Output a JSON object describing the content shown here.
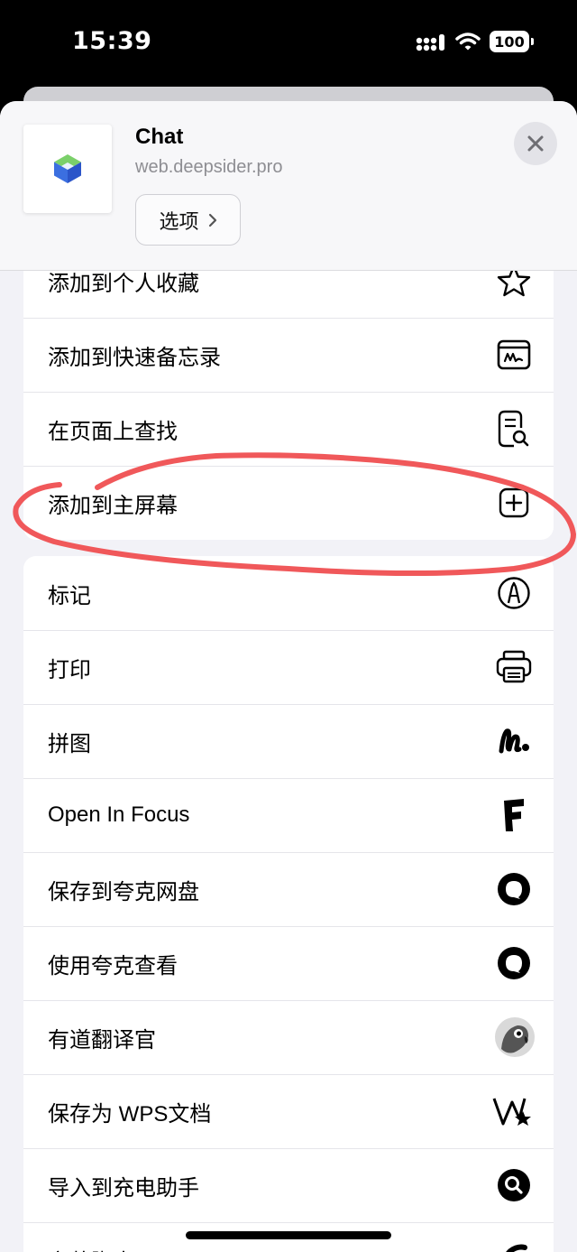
{
  "status_bar": {
    "time": "15:39",
    "battery": "100"
  },
  "header": {
    "title": "Chat",
    "url": "web.deepsider.pro",
    "options_label": "选项"
  },
  "group1": [
    {
      "label": "添加到个人收藏",
      "icon": "star-icon"
    },
    {
      "label": "添加到快速备忘录",
      "icon": "quick-note-icon"
    },
    {
      "label": "在页面上查找",
      "icon": "find-on-page-icon"
    },
    {
      "label": "添加到主屏幕",
      "icon": "add-square-icon"
    }
  ],
  "group2": [
    {
      "label": "标记",
      "icon": "markup-pen-icon"
    },
    {
      "label": "打印",
      "icon": "printer-icon"
    },
    {
      "label": "拼图",
      "icon": "freeform-icon"
    },
    {
      "label": "Open In Focus",
      "icon": "focus-f-icon"
    },
    {
      "label": "保存到夸克网盘",
      "icon": "quark-icon"
    },
    {
      "label": "使用夸克查看",
      "icon": "quark-icon"
    },
    {
      "label": "有道翻译官",
      "icon": "youdao-parrot-icon"
    },
    {
      "label": "保存为 WPS文档",
      "icon": "wps-icon"
    },
    {
      "label": "导入到充电助手",
      "icon": "search-circle-icon"
    },
    {
      "label": "安装脚本",
      "icon": "script-icon"
    }
  ],
  "colors": {
    "annotation": "#f0585a",
    "background": "#f2f2f7"
  }
}
